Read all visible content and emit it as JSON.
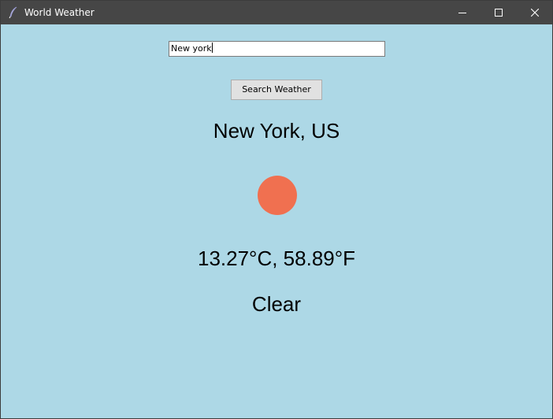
{
  "window": {
    "title": "World Weather",
    "app_icon": "feather-icon",
    "controls": {
      "minimize_icon": "minimize-icon",
      "maximize_icon": "maximize-icon",
      "close_icon": "close-icon"
    }
  },
  "search": {
    "value": "New york",
    "button_label": "Search Weather"
  },
  "result": {
    "location": "New York, US",
    "icon": "sun-icon",
    "icon_color": "#f07050",
    "temperature": "13.27°C, 58.89°F",
    "condition": "Clear"
  },
  "colors": {
    "background": "#add8e6",
    "titlebar": "#464646"
  }
}
